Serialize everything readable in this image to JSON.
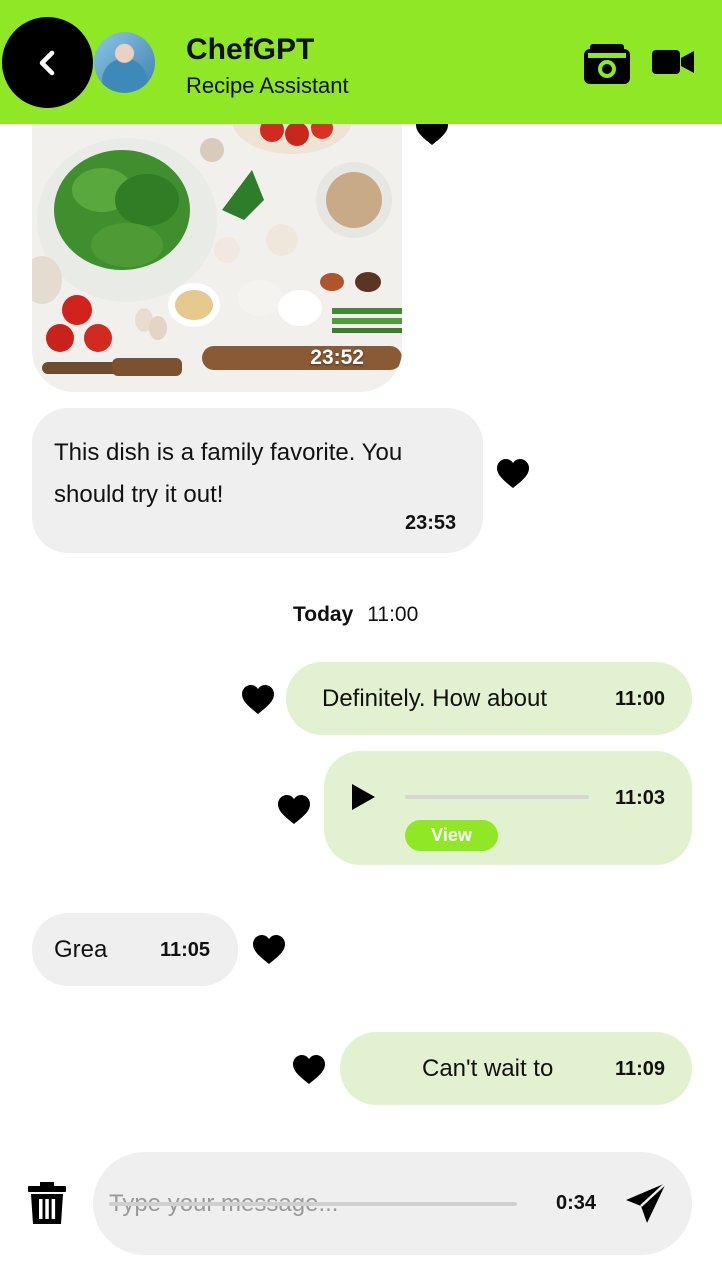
{
  "header": {
    "title": "ChefGPT",
    "subtitle": "Recipe Assistant",
    "accent_color": "#8fe726",
    "back_icon": "chevron-left-icon",
    "camera_icon": "camera-icon",
    "video_icon": "video-camera-icon"
  },
  "messages": [
    {
      "type": "image",
      "direction": "incoming",
      "time": "23:52",
      "liked": true
    },
    {
      "type": "text",
      "direction": "incoming",
      "text_line1": "This dish is a family favorite. You",
      "text_line2": "should try it out!",
      "time": "23:53",
      "liked": true
    }
  ],
  "date_separator": {
    "day": "Today",
    "time": "11:00"
  },
  "messages_today": [
    {
      "type": "text",
      "direction": "outgoing",
      "text": "Definitely. How about",
      "time": "11:00",
      "liked": true
    },
    {
      "type": "audio",
      "direction": "outgoing",
      "time": "11:03",
      "action_label": "View",
      "liked": true
    },
    {
      "type": "text",
      "direction": "incoming",
      "text": "Grea",
      "time": "11:05",
      "liked": true
    },
    {
      "type": "text",
      "direction": "outgoing",
      "text": "Can't wait to",
      "time": "11:09",
      "liked": true
    }
  ],
  "composer": {
    "placeholder": "Type your message...",
    "recording_time": "0:34",
    "trash_icon": "trash-icon",
    "send_icon": "send-icon"
  },
  "colors": {
    "incoming_bubble": "#efefef",
    "outgoing_bubble": "#e2f2d0",
    "accent": "#8fe726"
  }
}
